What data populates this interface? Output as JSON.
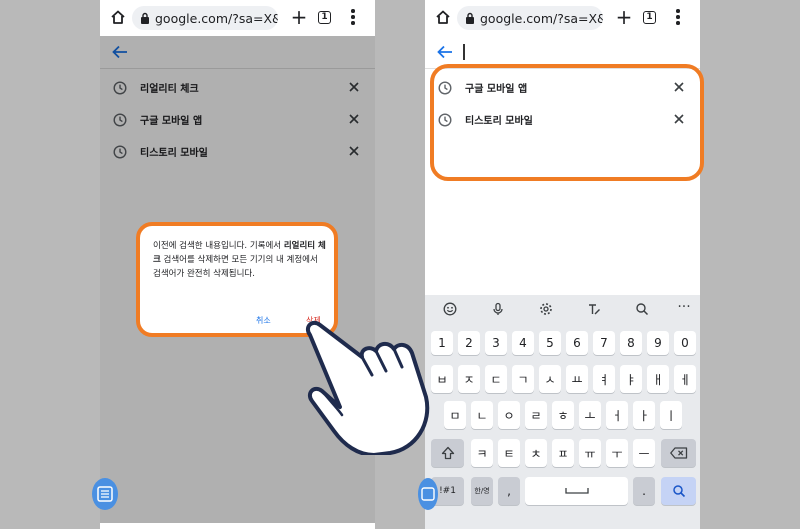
{
  "browser": {
    "url": "google.com/?sa=X&ve",
    "tab_count": "1"
  },
  "history": [
    "리얼리티 체크",
    "구글 모바일 앱",
    "티스토리 모바일"
  ],
  "history_right": [
    "구글 모바일 앱",
    "티스토리 모바일"
  ],
  "dialog": {
    "text_pre": "이전에 검색한 내용입니다. 기록에서 ",
    "text_bold": "리얼리티 체크",
    "text_post": " 검색어를 삭제하면 모든 기기의 내 계정에서 검색어가 완전히 삭제됩니다.",
    "cancel": "취소",
    "delete": "삭제"
  },
  "keyboard": {
    "row_numbers": [
      "1",
      "2",
      "3",
      "4",
      "5",
      "6",
      "7",
      "8",
      "9",
      "0"
    ],
    "row1": [
      "ㅂ",
      "ㅈ",
      "ㄷ",
      "ㄱ",
      "ㅅ",
      "ㅛ",
      "ㅕ",
      "ㅑ",
      "ㅐ",
      "ㅔ"
    ],
    "row2": [
      "ㅁ",
      "ㄴ",
      "ㅇ",
      "ㄹ",
      "ㅎ",
      "ㅗ",
      "ㅓ",
      "ㅏ",
      "ㅣ"
    ],
    "row3": [
      "ㅋ",
      "ㅌ",
      "ㅊ",
      "ㅍ",
      "ㅠ",
      "ㅜ",
      "ㅡ"
    ],
    "symbols_key": "!#1",
    "lang_key": "한/영",
    "comma": ",",
    "period": "."
  },
  "colors": {
    "highlight": "#f07c24",
    "link_blue": "#1a73e8",
    "delete_red": "#d93025"
  }
}
